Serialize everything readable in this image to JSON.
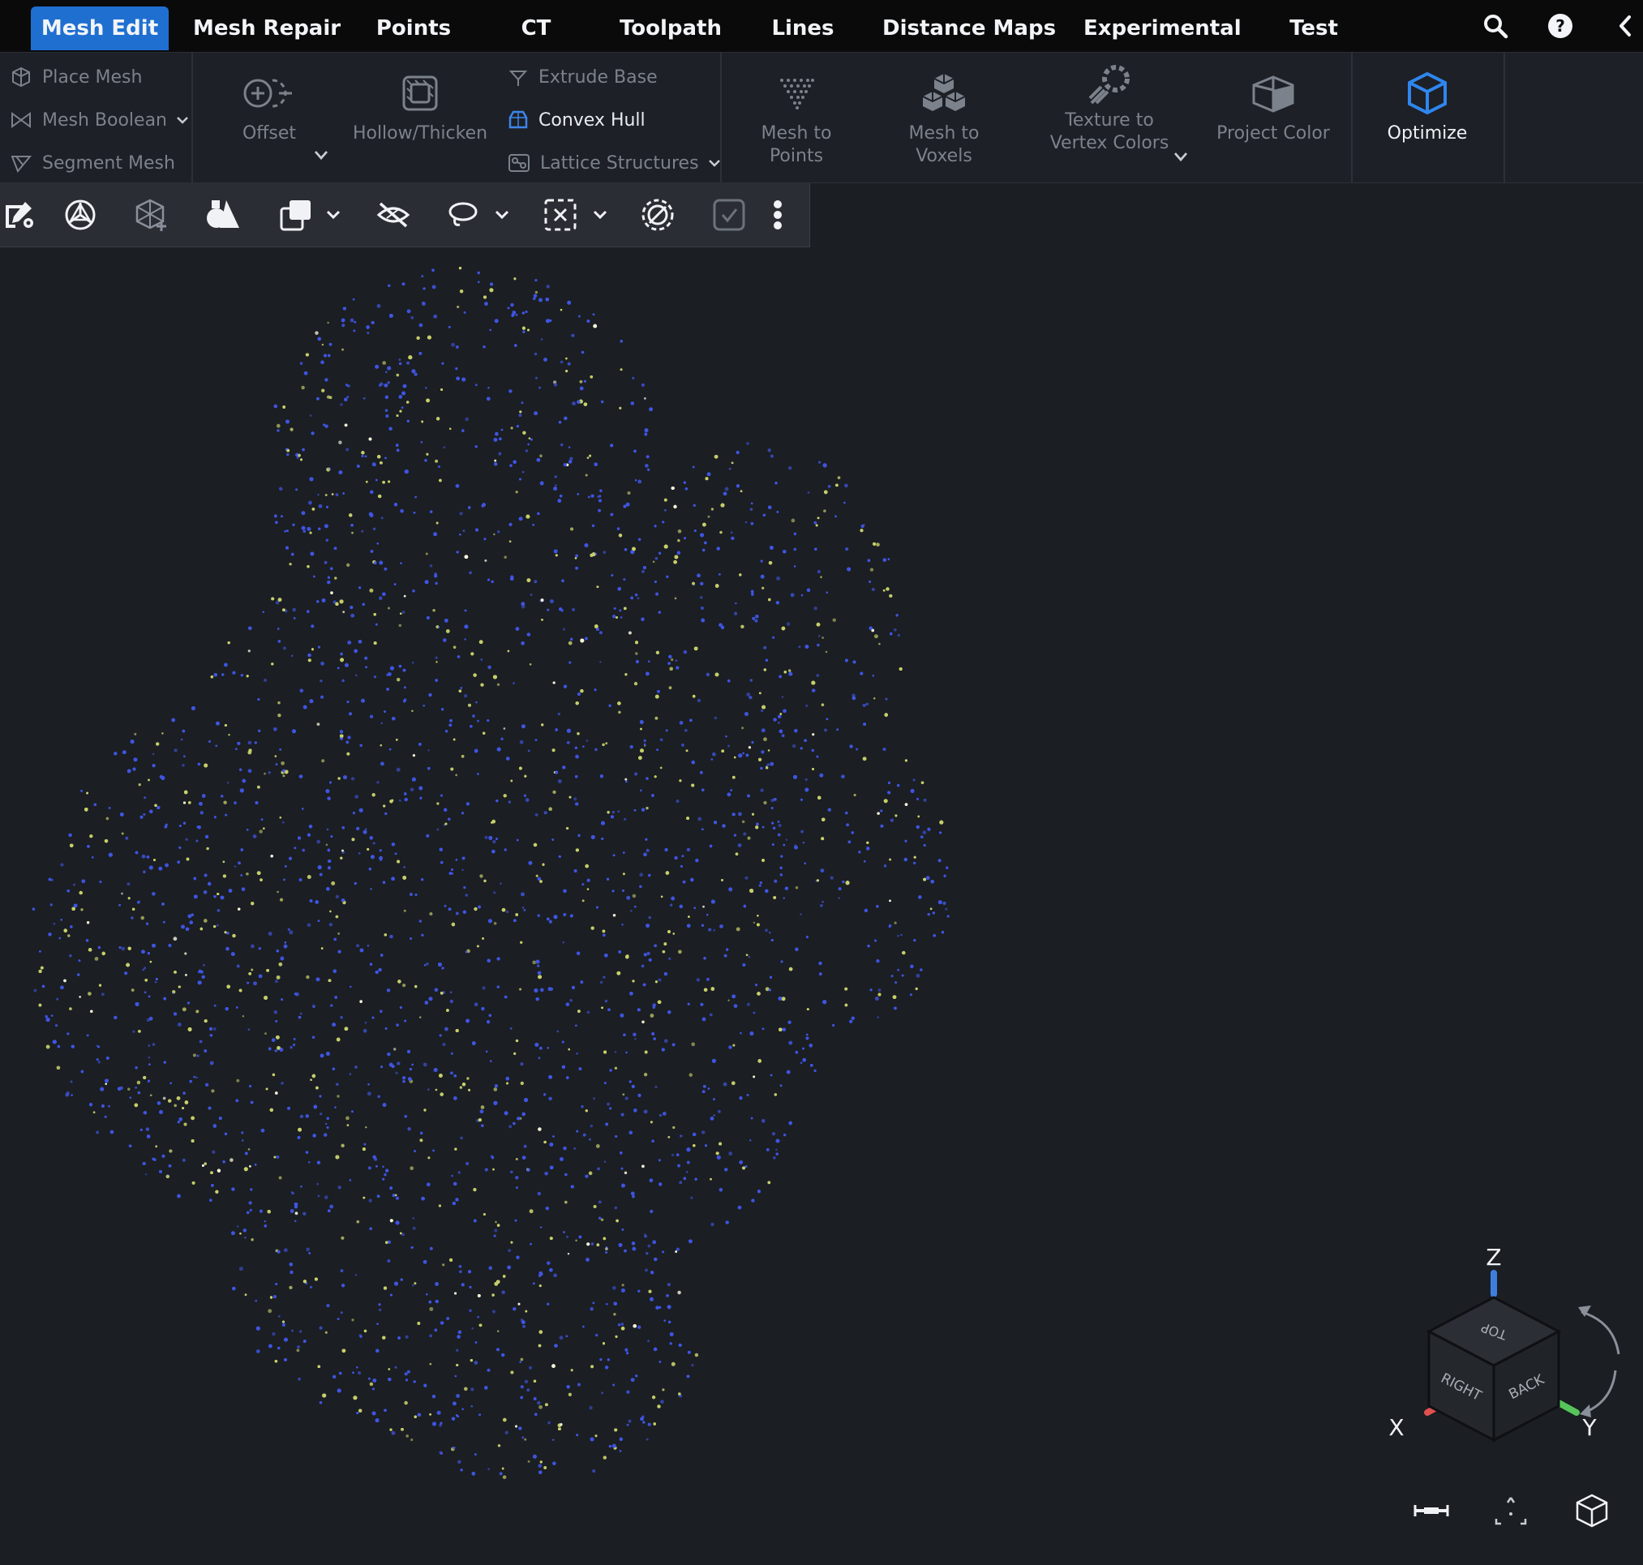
{
  "tabs": [
    {
      "label": "Mesh Edit",
      "active": true
    },
    {
      "label": "Mesh Repair"
    },
    {
      "label": "Points"
    },
    {
      "label": "CT"
    },
    {
      "label": "Toolpath"
    },
    {
      "label": "Lines"
    },
    {
      "label": "Distance Maps"
    },
    {
      "label": "Experimental"
    },
    {
      "label": "Test"
    }
  ],
  "topbar_icons": [
    "search-icon",
    "help-icon",
    "chevron-left-icon"
  ],
  "ribbon": {
    "left_group": {
      "place_mesh": "Place Mesh",
      "mesh_boolean": "Mesh Boolean",
      "segment_mesh": "Segment Mesh"
    },
    "offset": "Offset",
    "hollow_thicken": "Hollow/Thicken",
    "extrude_base": "Extrude Base",
    "convex_hull": "Convex Hull",
    "lattice_structures": "Lattice Structures",
    "mesh_to_points": "Mesh to Points",
    "mesh_to_voxels": "Mesh to Voxels",
    "texture_to_vertex_line1": "Texture to",
    "texture_to_vertex_line2": "Vertex Colors",
    "project_color": "Project Color",
    "optimize": "Optimize"
  },
  "viewport_toolbar_icons": [
    "edit-settings-icon",
    "mercedes-triangle-icon",
    "mesh-add-icon",
    "shapes-icon",
    "copy-window-icon",
    "hide-eye-icon",
    "lasso-icon",
    "box-select-icon",
    "deselect-circle-icon",
    "checkbox-icon",
    "more-vertical-icon"
  ],
  "view_cube": {
    "axis_z": "Z",
    "axis_x": "X",
    "axis_y": "Y",
    "face_top": "TOP",
    "face_right": "RIGHT",
    "face_back": "BACK"
  },
  "colors": {
    "accent": "#1f6fd1",
    "background": "#1b1e23",
    "point_blue": "#3f55e0",
    "point_yellow": "#c6cf6a",
    "axis_x": "#e05050",
    "axis_y": "#56c65a",
    "axis_z": "#3d7fe0"
  }
}
